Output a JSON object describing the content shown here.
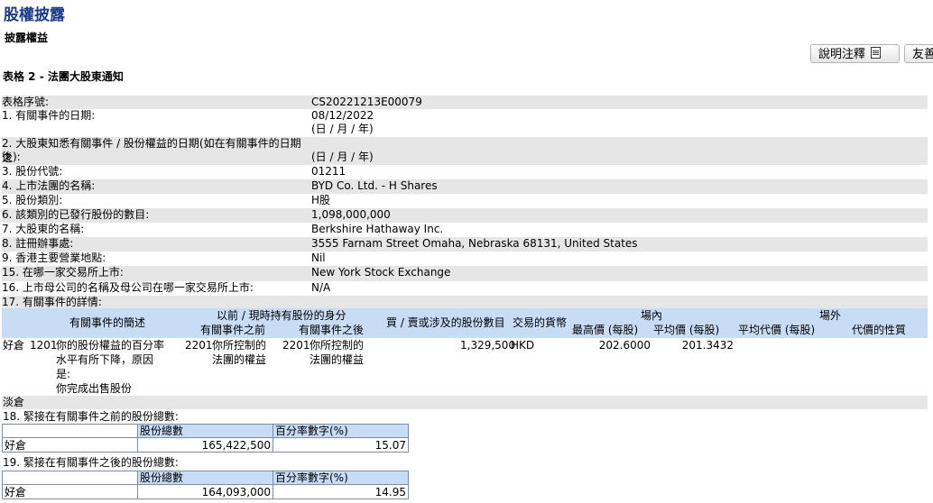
{
  "page": {
    "title": "股權披露",
    "section": "披露權益",
    "form_title": "表格 2 - 法團大股東通知"
  },
  "buttons": {
    "explain": "說明注釋",
    "friendly": "友善"
  },
  "fields": [
    {
      "label": "表格序號:",
      "value": "CS20221213E00079",
      "shade": true
    },
    {
      "label": "1. 有關事件的日期:",
      "value": "08/12/2022",
      "note": "(日 / 月 / 年)",
      "shade": false
    },
    {
      "label": "2. 大股東知悉有關事件 / 股份權益的日期(如在有關事件的日期之",
      "label2": "後):",
      "value": "",
      "note": "(日 / 月 / 年)",
      "shade": true
    },
    {
      "label": "3. 股份代號:",
      "value": "01211",
      "shade": false
    },
    {
      "label": "4. 上市法團的名稱:",
      "value": "BYD Co. Ltd. - H Shares",
      "shade": true
    },
    {
      "label": "5. 股份類別:",
      "value": "H股",
      "shade": false
    },
    {
      "label": "6. 該類別的已發行股份的數目:",
      "value": "1,098,000,000",
      "shade": true
    },
    {
      "label": "7. 大股東的名稱:",
      "value": "Berkshire Hathaway Inc.",
      "shade": false
    },
    {
      "label": "8. 註冊辦事處:",
      "value": "3555 Farnam Street Omaha, Nebraska 68131, United States",
      "shade": true
    },
    {
      "label": "9. 香港主要營業地點:",
      "value": "Nil",
      "shade": false
    },
    {
      "label": "15. 在哪一家交易所上市:",
      "value": "New York Stock Exchange",
      "shade": true
    },
    {
      "label": "16. 上市母公司的名稱及母公司在哪一家交易所上市:",
      "value": "N/A",
      "shade": false
    },
    {
      "label": "17. 有關事件的詳情:",
      "value": "",
      "shade": true
    }
  ],
  "detail": {
    "headers": {
      "event_desc": "有關事件的簡述",
      "shares_before_after": "以前 / 現時持有股份的身分",
      "before": "有關事件之前",
      "after": "有關事件之後",
      "shares_involved": "買 / 賣或涉及的股份數目",
      "currency": "交易的貨幣",
      "on_exchange": "場內",
      "highest_price": "最高價 (每股)",
      "average_price": "平均價 (每股)",
      "off_exchange": "場外",
      "avg_consideration": "平均代價 (每股)",
      "consideration_nature": "代價的性質"
    },
    "row": {
      "position": "好倉",
      "code": "1201",
      "desc_lines": [
        "你的股份權益的百分率",
        "水平有所下降，原因",
        "是:",
        "你完成出售股份"
      ],
      "before_code": "2201",
      "before_lines": [
        "你所控制的",
        "法團的權益"
      ],
      "after_code": "2201",
      "after_lines": [
        "你所控制的",
        "法團的權益"
      ],
      "shares": "1,329,500",
      "currency": "HKD",
      "highest_price": "202.6000",
      "average_price": "201.3432"
    },
    "short_label": "淡倉"
  },
  "totals_before": {
    "title": "18. 緊接在有關事件之前的股份總數:",
    "col_shares": "股份總數",
    "col_pct": "百分率數字(%)",
    "row_label": "好倉",
    "shares": "165,422,500",
    "pct": "15.07"
  },
  "totals_after": {
    "title": "19. 緊接在有關事件之後的股份總數:",
    "col_shares": "股份總數",
    "col_pct": "百分率數字(%)",
    "row_label": "好倉",
    "shares": "164,093,000",
    "pct": "14.95"
  }
}
